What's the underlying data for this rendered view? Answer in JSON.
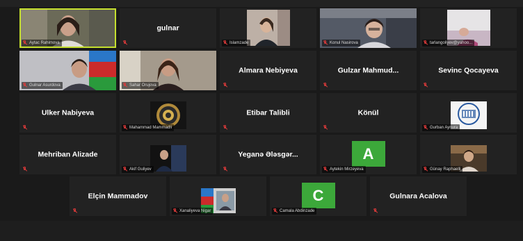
{
  "colors": {
    "active_border": "#c6e02e",
    "mute": "#e23b3b",
    "tile_bg": "#222222",
    "app_bg": "#1a1a1a"
  },
  "participants": [
    {
      "name": "Aytac Rahimova",
      "type": "video"
    },
    {
      "name": "gulnar",
      "type": "name"
    },
    {
      "name": "Islamzade",
      "type": "video"
    },
    {
      "name": "Konul Nasirova",
      "type": "video"
    },
    {
      "name": "tarlangoliyev@yahoo...",
      "type": "video"
    },
    {
      "name": "Gulnar Asurdova",
      "type": "video"
    },
    {
      "name": "Sahar Orujova",
      "type": "video"
    },
    {
      "name": "Almara Nebiyeva",
      "type": "name"
    },
    {
      "name": "Gulzar  Mahmud...",
      "type": "name"
    },
    {
      "name": "Sevinc Qocayeva",
      "type": "name"
    },
    {
      "name": "Ulker Nabiyeva",
      "type": "name"
    },
    {
      "name": "Mahammad Mammadli",
      "type": "video"
    },
    {
      "name": "Etibar Talibli",
      "type": "name"
    },
    {
      "name": "Könül",
      "type": "name"
    },
    {
      "name": "Gurban Aynura",
      "type": "video"
    },
    {
      "name": "Mehriban Alizade",
      "type": "name"
    },
    {
      "name": "Akif Guliyev",
      "type": "video"
    },
    {
      "name": "Yeganə  Ələsgər...",
      "type": "name"
    },
    {
      "name": "Aytekin Mirzeyeva",
      "type": "avatar",
      "initial": "A",
      "color": "#3ca83a"
    },
    {
      "name": "Günay Raphaelli",
      "type": "video"
    },
    {
      "name": "Elçin Mammadov",
      "type": "name"
    },
    {
      "name": "Xanaliyeva Nigar",
      "type": "video"
    },
    {
      "name": "Camala Abdinzade",
      "type": "avatar",
      "initial": "C",
      "color": "#3ca83a"
    },
    {
      "name": "Gulnara Acalova",
      "type": "name"
    }
  ]
}
